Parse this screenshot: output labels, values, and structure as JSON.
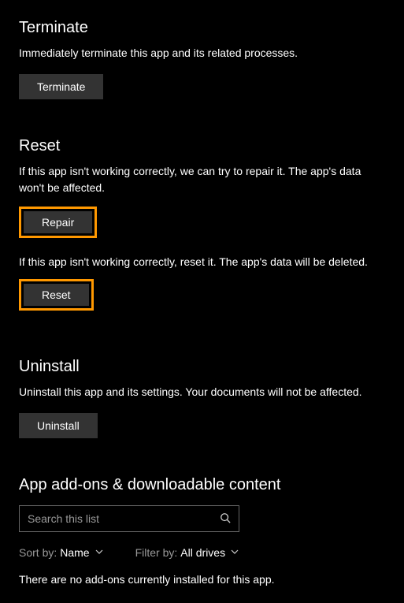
{
  "terminate": {
    "heading": "Terminate",
    "desc": "Immediately terminate this app and its related processes.",
    "button": "Terminate"
  },
  "reset": {
    "heading": "Reset",
    "repair_desc": "If this app isn't working correctly, we can try to repair it. The app's data won't be affected.",
    "repair_button": "Repair",
    "reset_desc": "If this app isn't working correctly, reset it. The app's data will be deleted.",
    "reset_button": "Reset"
  },
  "uninstall": {
    "heading": "Uninstall",
    "desc": "Uninstall this app and its settings. Your documents will not be affected.",
    "button": "Uninstall"
  },
  "addons": {
    "heading": "App add-ons & downloadable content",
    "search_placeholder": "Search this list",
    "sort_label": "Sort by:",
    "sort_value": "Name",
    "filter_label": "Filter by:",
    "filter_value": "All drives",
    "empty": "There are no add-ons currently installed for this app."
  }
}
